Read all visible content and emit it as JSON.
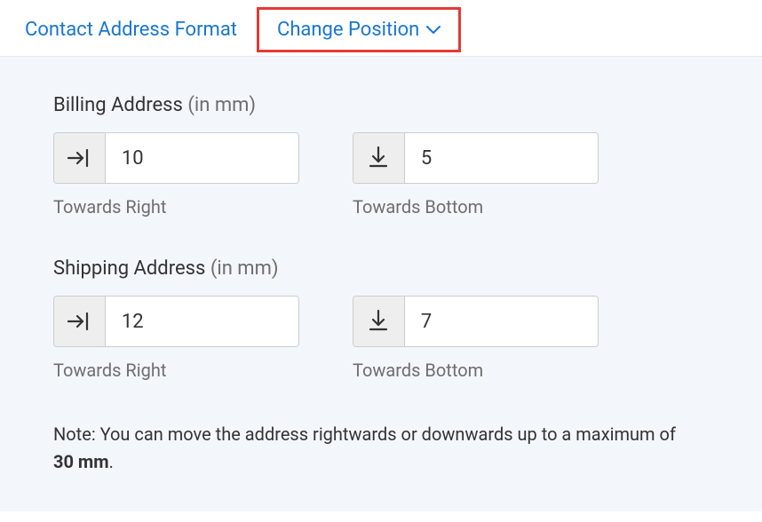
{
  "tabs": {
    "contact_address_format": "Contact Address Format",
    "change_position": "Change Position"
  },
  "billing": {
    "title": "Billing Address",
    "unit": "(in mm)",
    "right_value": "10",
    "right_hint": "Towards Right",
    "bottom_value": "5",
    "bottom_hint": "Towards Bottom"
  },
  "shipping": {
    "title": "Shipping Address",
    "unit": "(in mm)",
    "right_value": "12",
    "right_hint": "Towards Right",
    "bottom_value": "7",
    "bottom_hint": "Towards Bottom"
  },
  "note": {
    "prefix": "Note: You can move the address rightwards or downwards up to a maximum of ",
    "max": "30 mm",
    "suffix": "."
  }
}
